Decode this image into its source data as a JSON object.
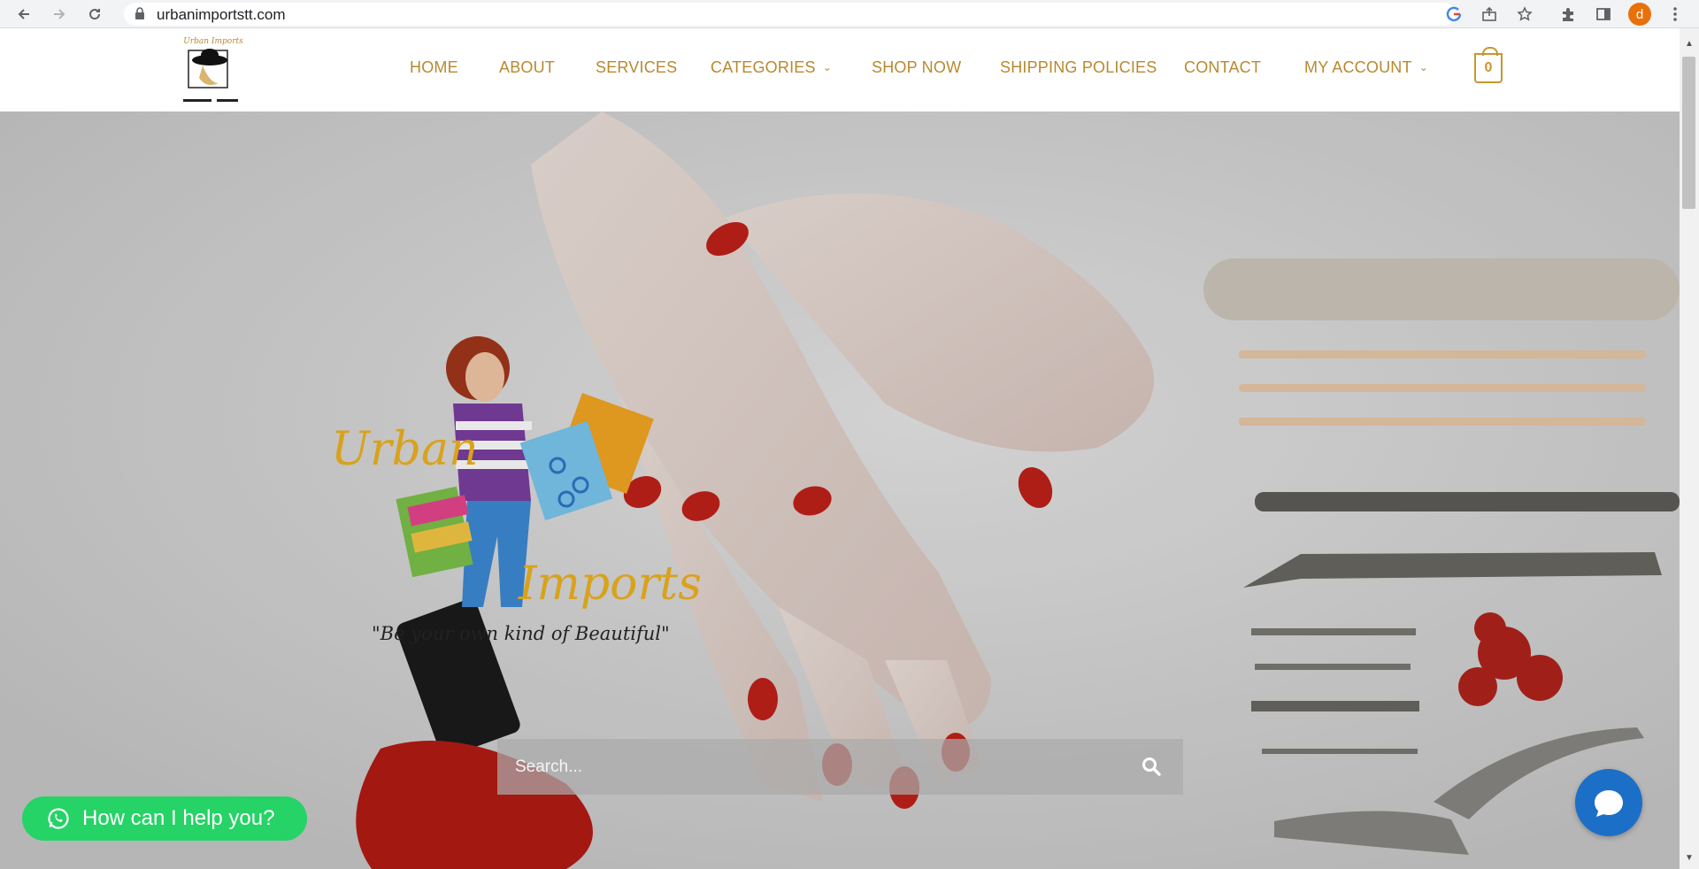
{
  "browser": {
    "url": "urbanimportstt.com",
    "profile_initial": "d",
    "icons": [
      "back-icon",
      "forward-icon",
      "reload-icon",
      "lock-icon",
      "google-icon",
      "share-icon",
      "star-icon",
      "extensions-icon",
      "sidebar-icon",
      "menu-icon"
    ]
  },
  "site": {
    "logo_alt": "Urban Imports",
    "nav": {
      "home": "HOME",
      "about": "ABOUT",
      "services": "SERVICES",
      "categories": "CATEGORIES",
      "shop_now": "SHOP NOW",
      "shipping": "SHIPPING POLICIES",
      "contact": "CONTACT",
      "my_account": "MY ACCOUNT"
    },
    "cart_count": "0",
    "accent_color": "#b8892f"
  },
  "hero": {
    "brand_word_1": "Urban",
    "brand_word_2": "Imports",
    "tagline": "\"Be your own kind of Beautiful\"",
    "search_placeholder": "Search..."
  },
  "widgets": {
    "help_label": "How can I help you?",
    "help_color": "#25d366",
    "chat_color": "#1c6fc7"
  }
}
